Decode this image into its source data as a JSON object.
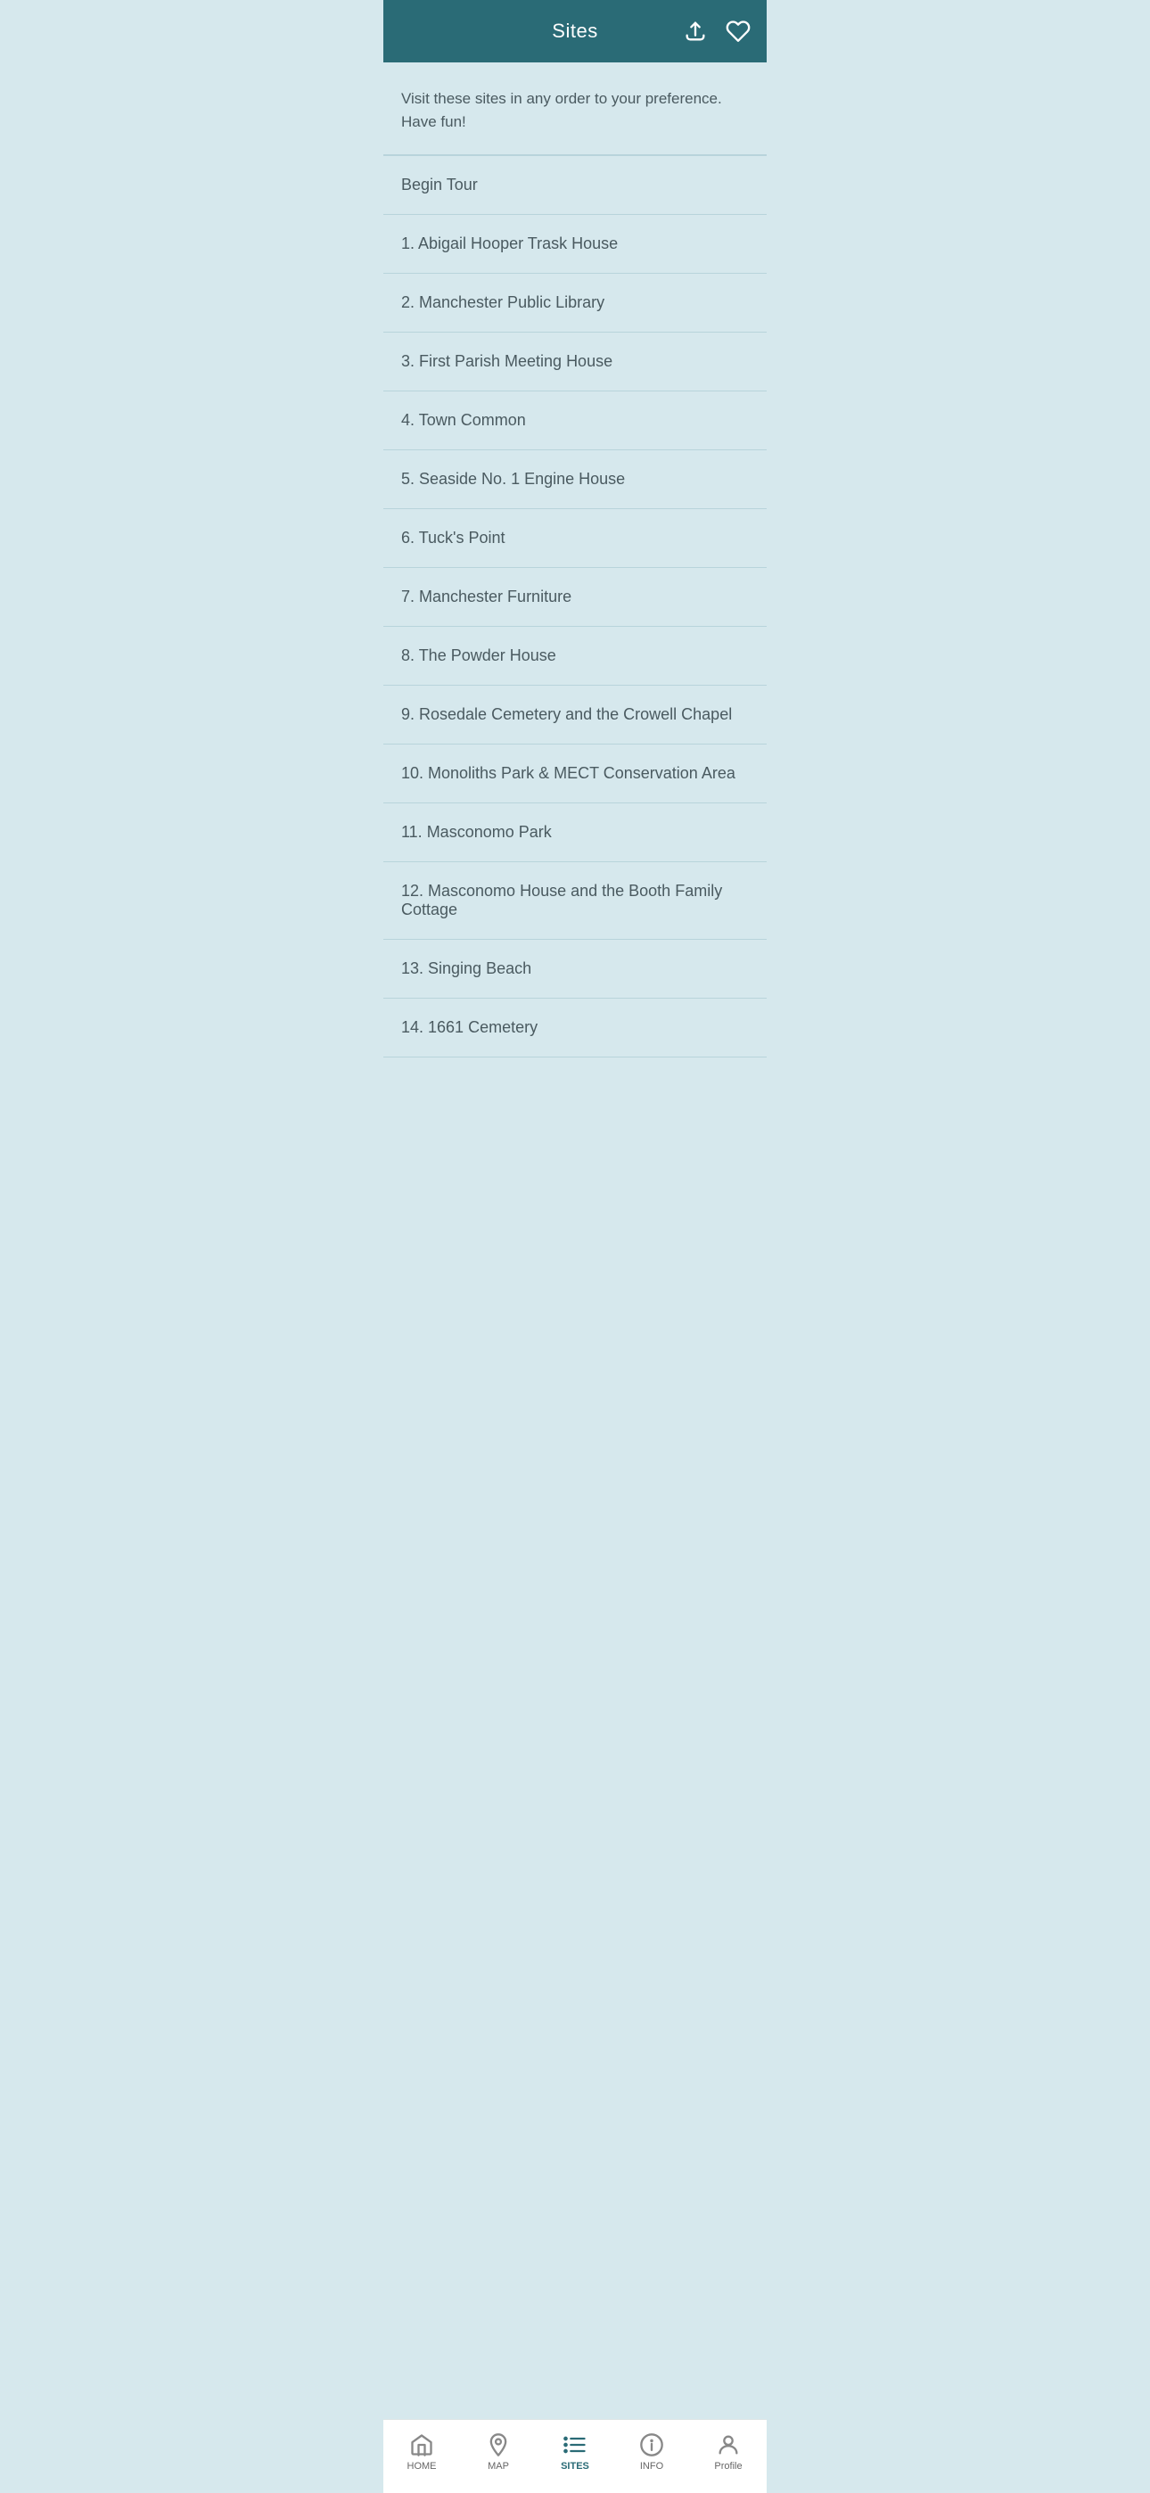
{
  "header": {
    "title": "Sites",
    "share_icon": "share-icon",
    "favorite_icon": "heart-icon"
  },
  "intro": {
    "text": "Visit these sites in any order to your preference. Have fun!"
  },
  "sites": [
    {
      "id": "begin",
      "label": "Begin Tour"
    },
    {
      "id": "site-1",
      "label": "1. Abigail Hooper Trask House"
    },
    {
      "id": "site-2",
      "label": "2. Manchester Public Library"
    },
    {
      "id": "site-3",
      "label": "3. First Parish Meeting House"
    },
    {
      "id": "site-4",
      "label": "4. Town Common"
    },
    {
      "id": "site-5",
      "label": "5. Seaside No. 1 Engine House"
    },
    {
      "id": "site-6",
      "label": "6. Tuck's Point"
    },
    {
      "id": "site-7",
      "label": "7. Manchester Furniture"
    },
    {
      "id": "site-8",
      "label": "8. The Powder House"
    },
    {
      "id": "site-9",
      "label": "9. Rosedale Cemetery and the Crowell Chapel"
    },
    {
      "id": "site-10",
      "label": "10. Monoliths Park & MECT Conservation Area"
    },
    {
      "id": "site-11",
      "label": "11. Masconomo Park"
    },
    {
      "id": "site-12",
      "label": "12. Masconomo House and the Booth Family Cottage"
    },
    {
      "id": "site-13",
      "label": "13. Singing Beach"
    },
    {
      "id": "site-14",
      "label": "14. 1661 Cemetery"
    }
  ],
  "bottomNav": {
    "items": [
      {
        "id": "home",
        "label": "HOME",
        "active": false
      },
      {
        "id": "map",
        "label": "MAP",
        "active": false
      },
      {
        "id": "sites",
        "label": "SITES",
        "active": true
      },
      {
        "id": "info",
        "label": "INFO",
        "active": false
      },
      {
        "id": "profile",
        "label": "Profile",
        "active": false
      }
    ]
  }
}
